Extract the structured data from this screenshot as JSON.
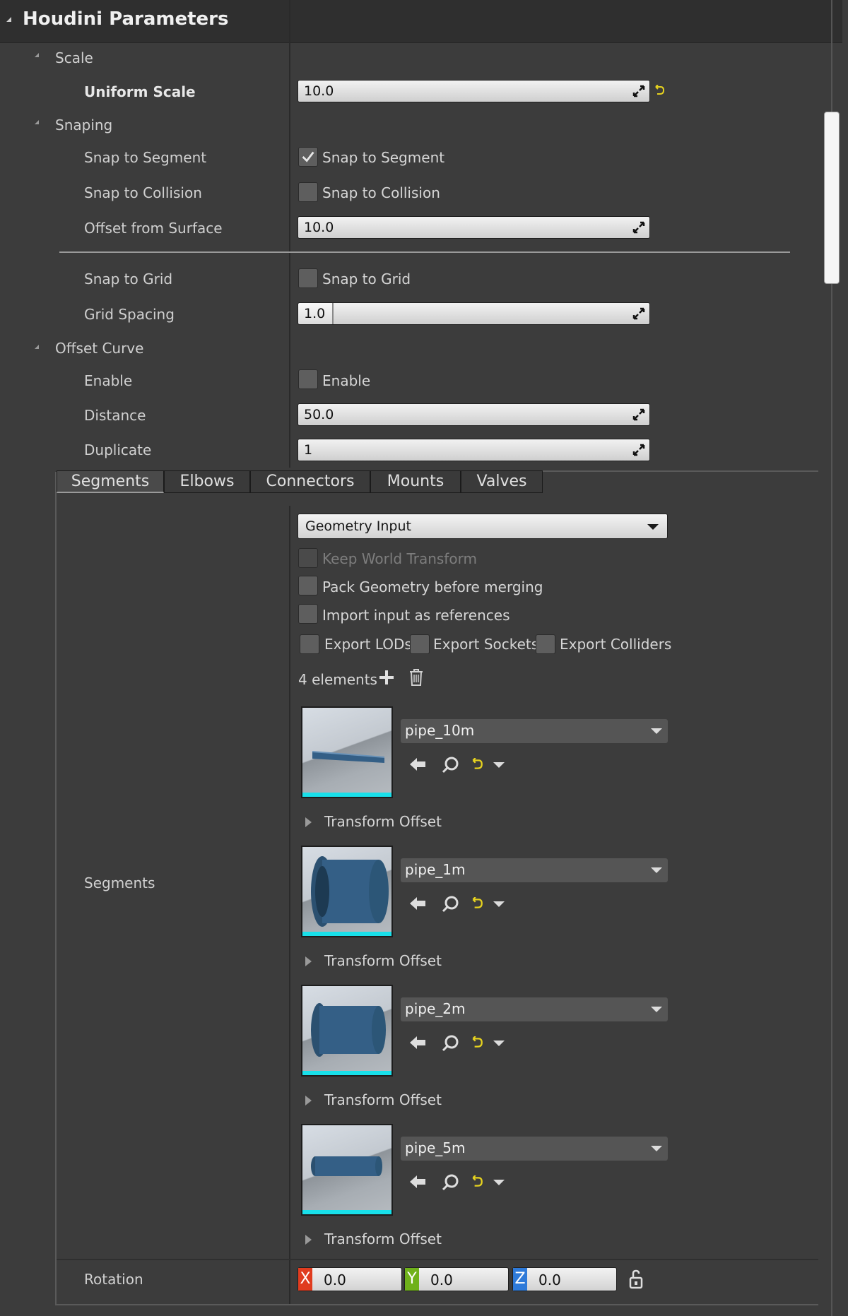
{
  "header": {
    "title": "Houdini Parameters"
  },
  "groups": {
    "scale": "Scale",
    "snaping": "Snaping",
    "offset_curve": "Offset Curve"
  },
  "params": {
    "uniform_scale": {
      "label": "Uniform Scale",
      "value": "10.0"
    },
    "snap_to_segment": {
      "label": "Snap to Segment",
      "text": "Snap to Segment",
      "checked": true
    },
    "snap_to_collision": {
      "label": "Snap to Collision",
      "text": "Snap to Collision",
      "checked": false
    },
    "offset_from_surface": {
      "label": "Offset from Surface",
      "value": "10.0"
    },
    "snap_to_grid": {
      "label": "Snap to Grid",
      "text": "Snap to Grid",
      "checked": false
    },
    "grid_spacing": {
      "label": "Grid Spacing",
      "value": "1.0",
      "slider_fraction": 0.1
    },
    "enable": {
      "label": "Enable",
      "text": "Enable",
      "checked": false
    },
    "distance": {
      "label": "Distance",
      "value": "50.0"
    },
    "duplicate": {
      "label": "Duplicate",
      "value": "1"
    }
  },
  "tabs": [
    "Segments",
    "Elbows",
    "Connectors",
    "Mounts",
    "Valves"
  ],
  "active_tab": "Segments",
  "segments_panel": {
    "label": "Segments",
    "input_type": "Geometry Input",
    "keep_world_transform": "Keep World Transform",
    "pack_geometry": "Pack Geometry before merging",
    "import_as_references": "Import input as references",
    "export_lods": "Export LODs",
    "export_sockets": "Export Sockets",
    "export_colliders": "Export Colliders",
    "element_count": "4 elements",
    "transform_offset": "Transform Offset",
    "items": [
      {
        "name": "pipe_10m"
      },
      {
        "name": "pipe_1m"
      },
      {
        "name": "pipe_2m"
      },
      {
        "name": "pipe_5m"
      }
    ]
  },
  "rotation": {
    "label": "Rotation",
    "x": "0.0",
    "y": "0.0",
    "z": "0.0",
    "x_tag": "X",
    "y_tag": "Y",
    "z_tag": "Z"
  },
  "colors": {
    "accent_cyan": "#19e0ea",
    "x_red": "#e03c1f",
    "y_green": "#6fb11b",
    "z_blue": "#2e7ad9",
    "reset_yellow": "#e6d21f"
  }
}
